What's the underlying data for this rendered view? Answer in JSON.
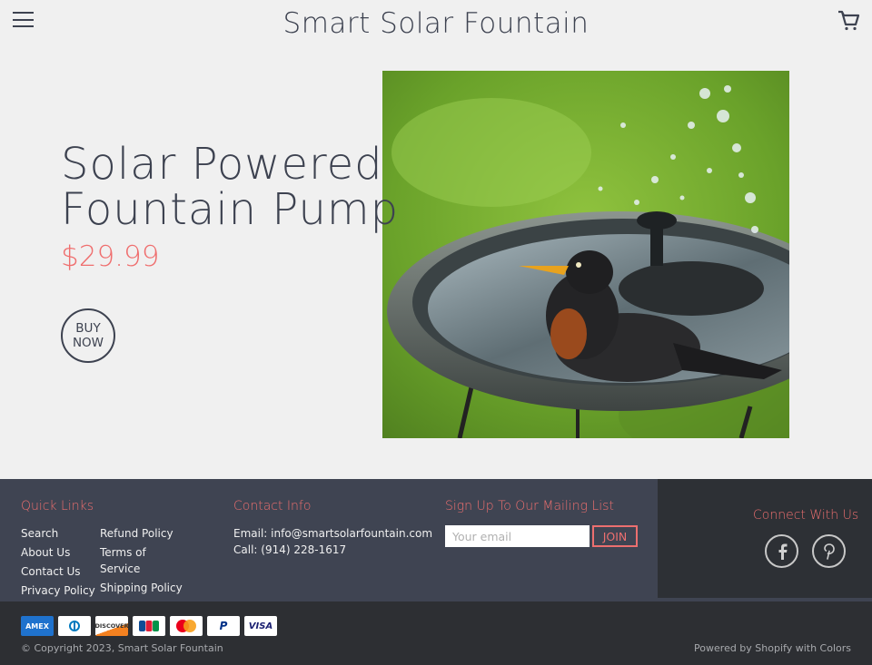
{
  "header": {
    "site_title": "Smart Solar Fountain",
    "menu_icon": "hamburger-menu-icon",
    "cart_icon": "shopping-cart-icon"
  },
  "product": {
    "title_line1": "Solar Powered",
    "title_line2": "Fountain Pump",
    "price": "$29.99",
    "buy_line1": "BUY",
    "buy_line2": "NOW",
    "image_alt": "Robin bathing in a bird bath with a solar fountain spraying water"
  },
  "footer": {
    "quick_links": {
      "heading": "Quick Links",
      "col1": [
        "Search",
        "About Us",
        "Contact Us",
        "Privacy Policy"
      ],
      "col2": [
        "Refund Policy",
        "Terms of",
        "Service",
        "Shipping Policy"
      ]
    },
    "contact": {
      "heading": "Contact Info",
      "email": "Email: info@smartsolarfountain.com",
      "phone": "Call: (914) 228-1617"
    },
    "mailing": {
      "heading": "Sign Up To Our Mailing List",
      "placeholder": "Your email",
      "join_label": "JOIN"
    },
    "social": {
      "heading": "Connect With Us",
      "facebook_glyph": "f",
      "pinterest_glyph": "P"
    },
    "payments": [
      "AMEX",
      "Diners Club",
      "DISCOVER",
      "JCB",
      "Mastercard",
      "PayPal",
      "VISA"
    ],
    "copyright": "© Copyright 2023, Smart Solar Fountain",
    "powered_by": "Powered by Shopify with Colors"
  },
  "colors": {
    "accent": "#ec6f6f",
    "text": "#3d4250",
    "background": "#f0f0f0",
    "footer": "#3f4452",
    "footer_dark": "#2d2f33"
  }
}
